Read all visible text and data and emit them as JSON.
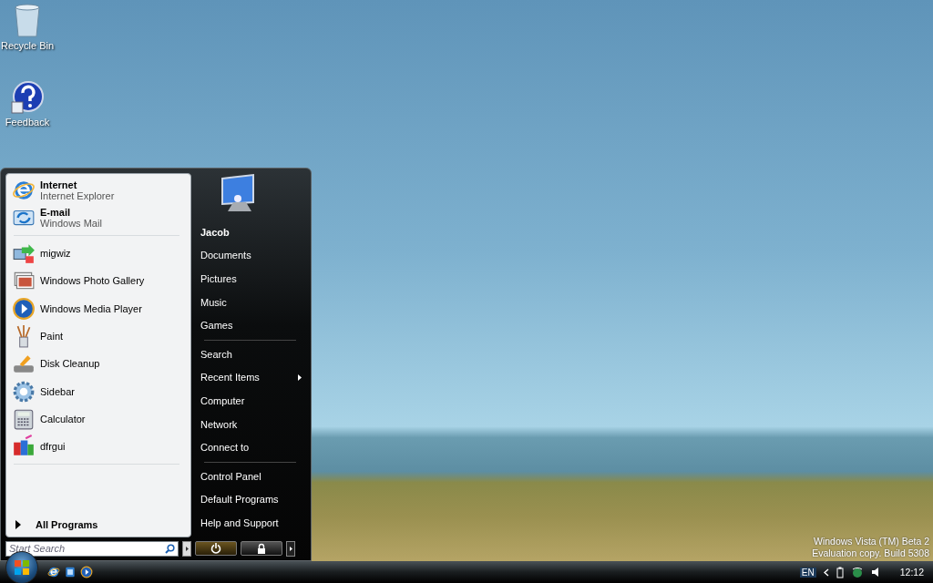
{
  "desktop_icons": [
    {
      "label": "Recycle Bin",
      "kind": "bin"
    },
    {
      "label": "Feedback",
      "kind": "help"
    }
  ],
  "start_menu": {
    "pinned": [
      {
        "title": "Internet",
        "subtitle": "Internet Explorer",
        "kind": "browser"
      },
      {
        "title": "E-mail",
        "subtitle": "Windows Mail",
        "kind": "mail"
      }
    ],
    "recent": [
      {
        "label": "migwiz",
        "kind": "migrate"
      },
      {
        "label": "Windows Photo Gallery",
        "kind": "photos"
      },
      {
        "label": "Windows Media Player",
        "kind": "media"
      },
      {
        "label": "Paint",
        "kind": "paint"
      },
      {
        "label": "Disk Cleanup",
        "kind": "cleanup"
      },
      {
        "label": "Sidebar",
        "kind": "gear"
      },
      {
        "label": "Calculator",
        "kind": "calc"
      },
      {
        "label": "dfrgui",
        "kind": "defrag"
      }
    ],
    "all_programs": "All Programs",
    "search": {
      "placeholder": "Start Search"
    },
    "places": [
      [
        {
          "label": "Jacob",
          "bold": true,
          "has_submenu": false
        },
        {
          "label": "Documents",
          "bold": false,
          "has_submenu": false
        },
        {
          "label": "Pictures",
          "bold": false,
          "has_submenu": false
        },
        {
          "label": "Music",
          "bold": false,
          "has_submenu": false
        },
        {
          "label": "Games",
          "bold": false,
          "has_submenu": false
        }
      ],
      [
        {
          "label": "Search",
          "bold": false,
          "has_submenu": false
        },
        {
          "label": "Recent Items",
          "bold": false,
          "has_submenu": true
        },
        {
          "label": "Computer",
          "bold": false,
          "has_submenu": false
        },
        {
          "label": "Network",
          "bold": false,
          "has_submenu": false
        },
        {
          "label": "Connect to",
          "bold": false,
          "has_submenu": false
        }
      ],
      [
        {
          "label": "Control Panel",
          "bold": false,
          "has_submenu": false
        },
        {
          "label": "Default Programs",
          "bold": false,
          "has_submenu": false
        },
        {
          "label": "Help and Support",
          "bold": false,
          "has_submenu": false
        }
      ]
    ]
  },
  "build_notice": [
    "Windows Vista (TM) Beta 2",
    "Evaluation copy. Build 5308"
  ],
  "taskbar": {
    "quick_launch": [
      {
        "kind": "browser"
      },
      {
        "kind": "switch"
      },
      {
        "kind": "media"
      }
    ],
    "language": "EN",
    "clock": "12:12"
  }
}
